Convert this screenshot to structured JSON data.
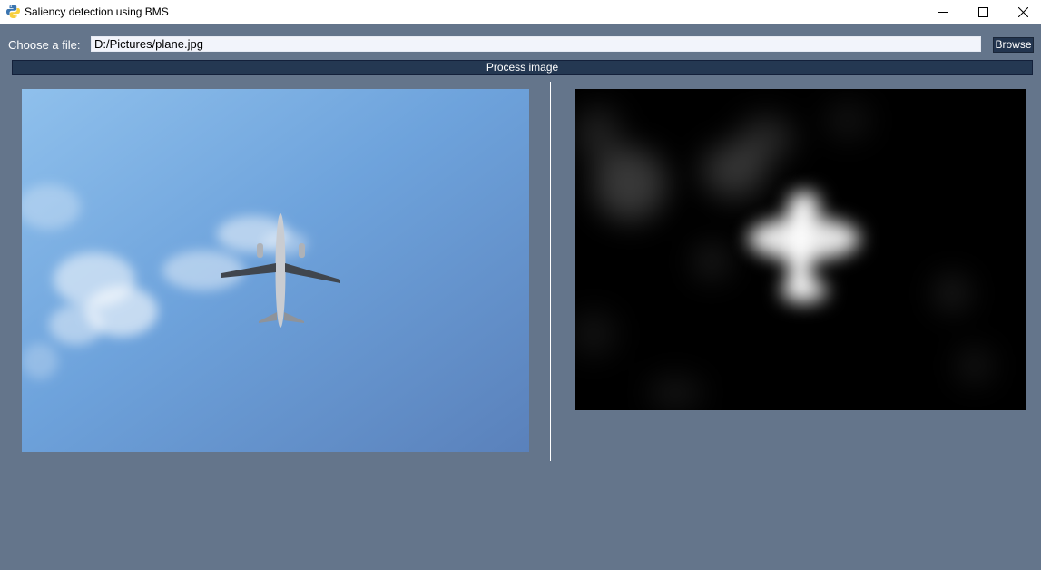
{
  "window": {
    "title": "Saliency detection using BMS",
    "minimize_glyph": "—",
    "maximize_glyph": "☐",
    "close_glyph": "✕",
    "icon": "python-icon"
  },
  "file_picker": {
    "label": "Choose a file:",
    "value": "D:/Pictures/plane.jpg",
    "browse_label": "Browse"
  },
  "process": {
    "label": "Process image"
  },
  "images": {
    "source": "airplane-sky-photo",
    "saliency": "saliency-map"
  },
  "colors": {
    "background": "#64758b",
    "button": "#243852",
    "input": "#f2f4fb"
  }
}
